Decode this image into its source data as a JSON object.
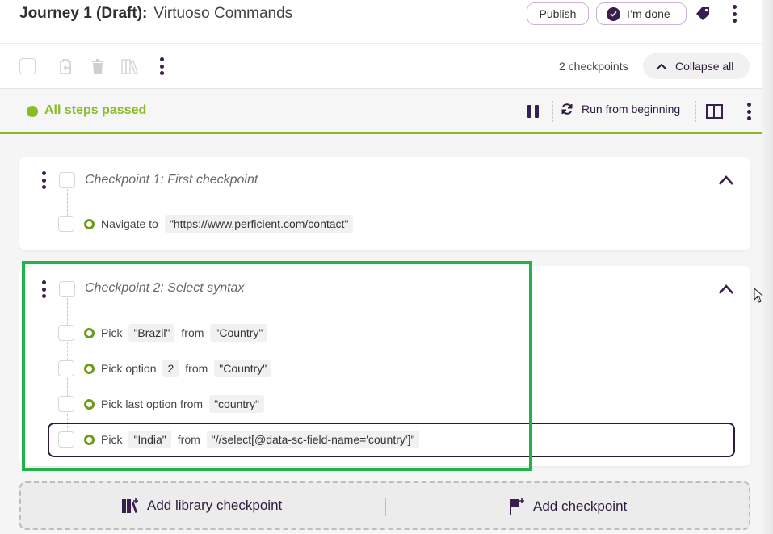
{
  "header": {
    "title_bold": "Journey 1 (Draft):",
    "title_sub": "Virtuoso Commands",
    "publish_label": "Publish",
    "done_label": "I’m done",
    "icons": [
      "check-circle-icon",
      "tag-icon",
      "kebab-menu-icon"
    ]
  },
  "toolbar": {
    "icons": [
      "checkbox",
      "paste-icon",
      "trash-icon",
      "library-icon",
      "kebab-menu-icon"
    ],
    "checkpoints_count": "2 checkpoints",
    "collapse_all_label": "Collapse all"
  },
  "status": {
    "text": "All steps passed",
    "color": "#8bbb25",
    "run_label": "Run from beginning"
  },
  "checkpoints": [
    {
      "title": "Checkpoint 1:  First checkpoint",
      "steps": [
        {
          "action": "Navigate to",
          "arg1": "\"https://www.perficient.com/contact\""
        }
      ]
    },
    {
      "title": "Checkpoint 2:  Select syntax",
      "steps": [
        {
          "action": "Pick",
          "arg1": "\"Brazil\"",
          "mid": "from",
          "arg2": "\"Country\""
        },
        {
          "action": "Pick option",
          "arg1": "2",
          "mid": "from",
          "arg2": "\"Country\""
        },
        {
          "action": "Pick last option from",
          "arg1": "\"country\""
        },
        {
          "action": "Pick",
          "arg1": "\"India\"",
          "mid": "from",
          "arg2": "\"//select[@data-sc-field-name='country']\""
        }
      ]
    }
  ],
  "add_bar": {
    "library_label": "Add library checkpoint",
    "checkpoint_label": "Add checkpoint"
  },
  "colors": {
    "accent": "#3a1e4e",
    "passed": "#8bbb25",
    "highlight": "#22b24c"
  }
}
